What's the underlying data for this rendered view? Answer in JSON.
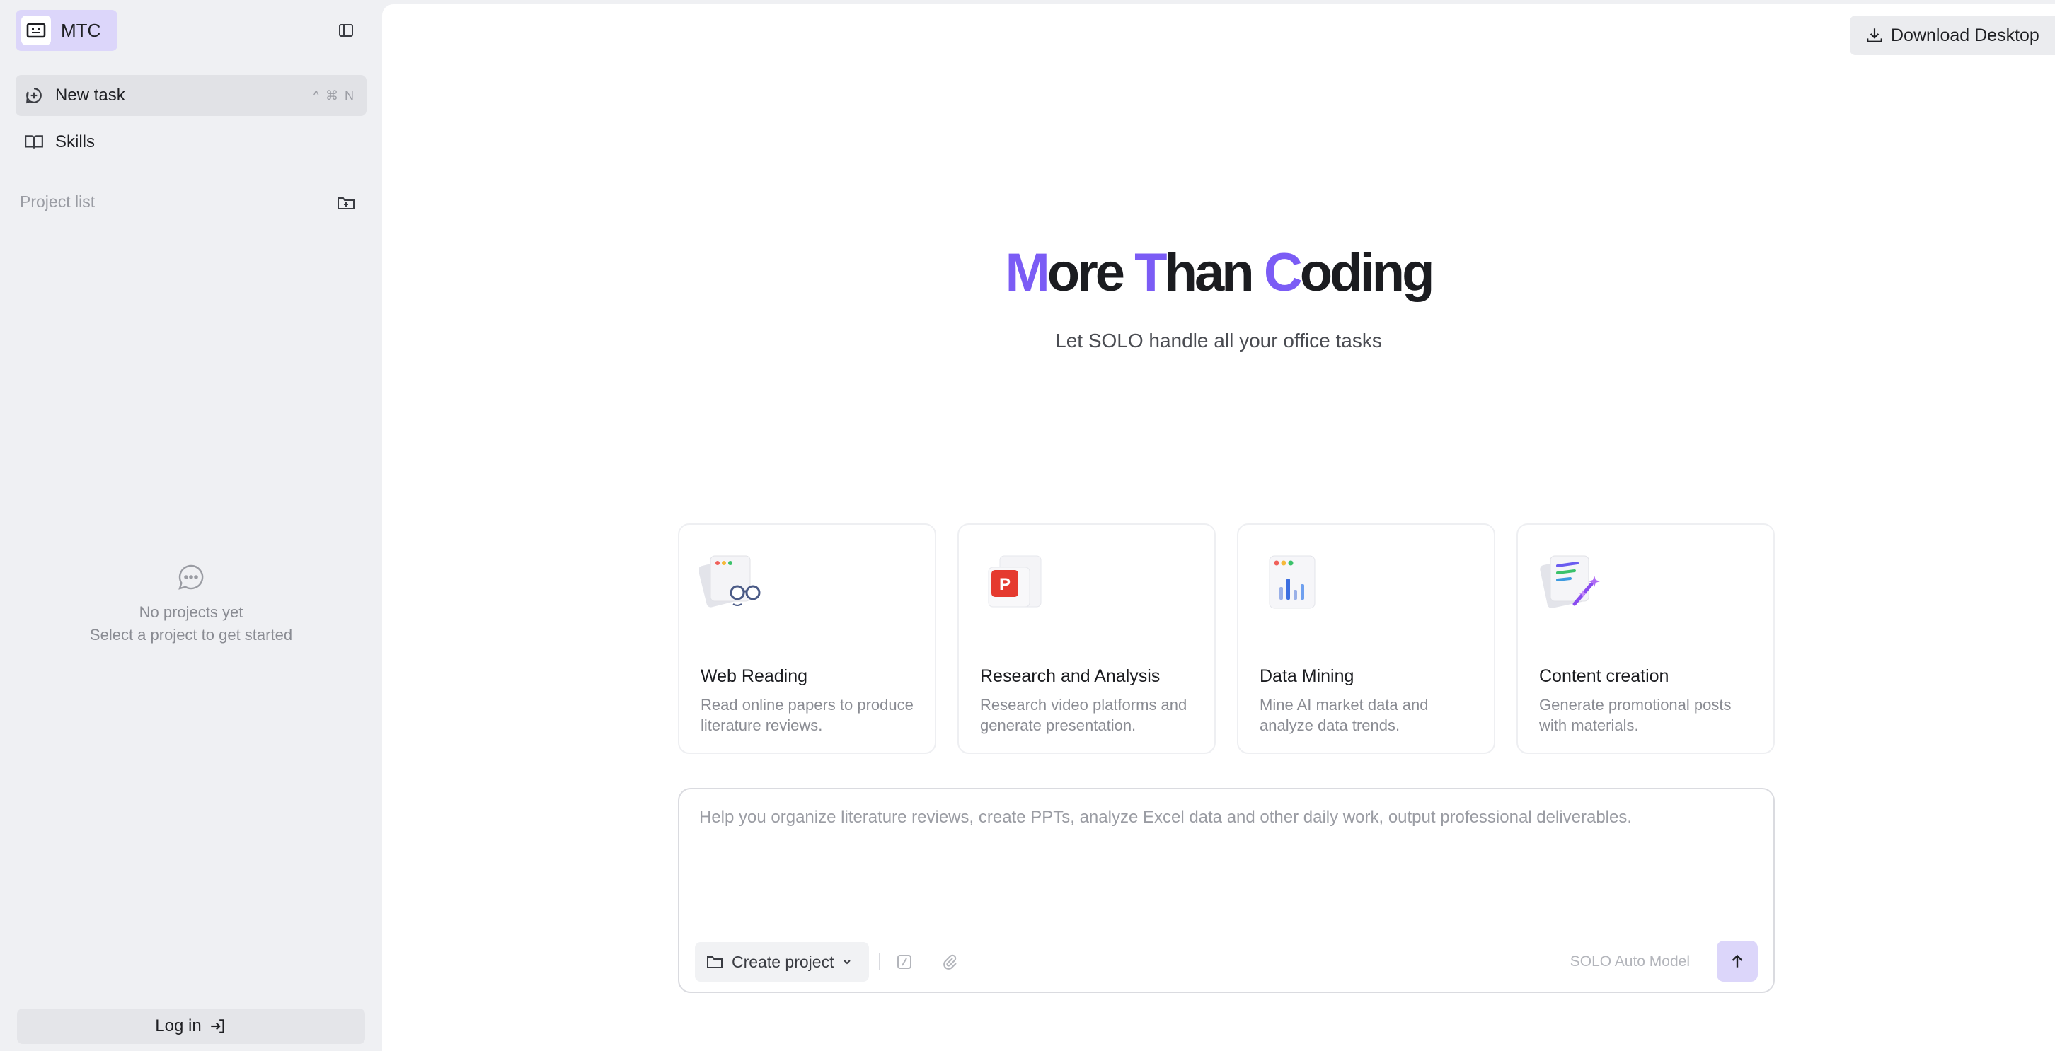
{
  "sidebar": {
    "brand": {
      "name": "MTC"
    },
    "nav": [
      {
        "label": "New task",
        "shortcut": "^ ⌘ N",
        "icon": "plus-circle-icon"
      },
      {
        "label": "Skills",
        "icon": "book-icon"
      }
    ],
    "project_list_label": "Project list",
    "empty_state": {
      "line1": "No projects yet",
      "line2": "Select a project to get started"
    },
    "login_label": "Log in"
  },
  "main": {
    "download_label": "Download Desktop",
    "hero": {
      "title_parts": [
        "M",
        "ore ",
        "T",
        "han ",
        "C",
        "oding"
      ],
      "subtitle": "Let SOLO handle all your office tasks"
    },
    "cards": [
      {
        "title": "Web Reading",
        "desc": "Read online papers to produce literature reviews.",
        "icon": "web-reading-illustration"
      },
      {
        "title": "Research and Analysis",
        "desc": "Research video platforms and generate presentation.",
        "icon": "presentation-illustration"
      },
      {
        "title": "Data Mining",
        "desc": "Mine AI market data and analyze data trends.",
        "icon": "bar-chart-illustration"
      },
      {
        "title": "Content creation",
        "desc": "Generate promotional posts with materials.",
        "icon": "content-creation-illustration"
      }
    ],
    "composer": {
      "placeholder": "Help you organize literature reviews, create PPTs, analyze Excel data and other daily work, output professional deliverables.",
      "create_project_label": "Create project",
      "model_label": "SOLO Auto Model"
    }
  },
  "colors": {
    "accent": "#7b5cf5",
    "brand_bg": "#dcd6fa",
    "sidebar_bg": "#eff0f3"
  }
}
